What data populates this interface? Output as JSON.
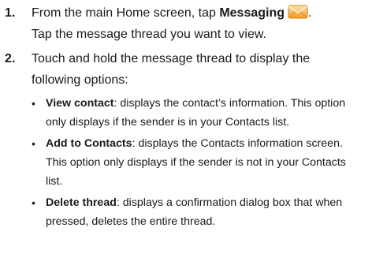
{
  "steps": [
    {
      "number": "1.",
      "text_before": "From the main Home screen, tap ",
      "bold": "Messaging",
      "text_after": ".",
      "line2": "Tap the message thread you want to view."
    },
    {
      "number": "2.",
      "line1": "Touch and hold the message thread to display the",
      "line2": "following options:"
    }
  ],
  "options": [
    {
      "label": "View contact",
      "sep": ":",
      "line1": " displays the contact’s information. This option",
      "line2": "only displays if the sender is in your Contacts list.",
      "line3": ""
    },
    {
      "label": "Add to Contacts",
      "sep": ":",
      "line1": " displays the Contacts information screen.",
      "line2": "This option only displays if the sender is not in your Contacts",
      "line3": "list."
    },
    {
      "label": "Delete thread",
      "sep": ":",
      "line1": " displays a confirmation dialog box that when",
      "line2": "pressed, deletes the entire thread.",
      "line3": ""
    }
  ],
  "icons": {
    "messaging": "messaging-envelope-icon"
  },
  "colors": {
    "text": "#1a1a1a",
    "icon_orange": "#f29a1a",
    "icon_light": "#fde3b0"
  }
}
